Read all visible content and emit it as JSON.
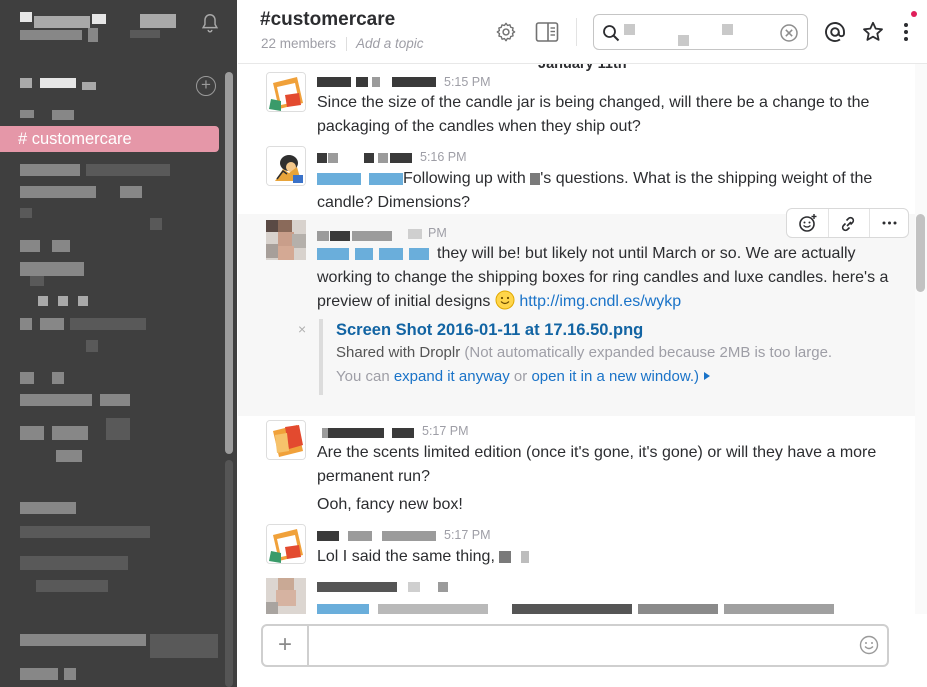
{
  "header": {
    "channel_title": "#customercare",
    "member_count": "22 members",
    "add_topic": "Add a topic",
    "search_value": ""
  },
  "sidebar": {
    "active_channel": "# customercare"
  },
  "date_divider": "January 11th",
  "messages": [
    {
      "time": "5:15 PM",
      "text": "Since the size of the candle jar is being changed, will there be a change to the packaging of the candles when they ship out?"
    },
    {
      "time": "5:16 PM",
      "text_a": "Following up with",
      "text_b": "'s questions. What is the shipping weight of the candle? Dimensions?"
    },
    {
      "time_partial": "PM",
      "text_a": "they will be! but likely not until March or so. We are actually working to change the shipping boxes for ring candles and luxe candles. here's a preview of initial designs",
      "link": "http://img.cndl.es/wykp",
      "attachment": {
        "title": "Screen Shot 2016-01-11 at 17.16.50.png",
        "shared_with": "Shared with Droplr",
        "note": "(Not automatically expanded because 2MB is too large.",
        "you_can": "You can",
        "expand_link": "expand it anyway",
        "or": "or",
        "open_link": "open it in a new window.)",
        "close": "×"
      }
    },
    {
      "time": "5:17 PM",
      "text": "Are the scents limited edition (once it's gone, it's gone)  or will they have a more permanent run?",
      "text2": "Ooh, fancy new box!"
    },
    {
      "time": "5:17 PM",
      "text": "Lol I said the same thing,"
    }
  ],
  "composer": {
    "placeholder": "",
    "plus": "+"
  },
  "colors": {
    "sidebar_bg": "#3f3f3f",
    "active_channel": "#e597a8",
    "link": "#1a73c8"
  }
}
